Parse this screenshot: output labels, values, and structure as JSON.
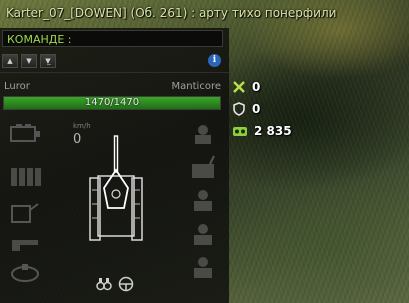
{
  "chat": {
    "message": "Karter_07_[DOWEN] (Об. 261) : арту тихо понерфили"
  },
  "team_chat": {
    "label": "КОМАНДЕ :"
  },
  "controls": {
    "icons": [
      "arrow-up-icon",
      "arrow-down-icon",
      "arrow-down-bar-icon"
    ],
    "info_icon": "i"
  },
  "vehicle": {
    "player_name": "Luror",
    "tank_name": "Manticore",
    "hp_current": 1470,
    "hp_max": 1470,
    "hp_text": "1470/1470",
    "speed_unit": "km/h",
    "speed_value": "0"
  },
  "stats": {
    "damage_assisted": "0",
    "damage_blocked": "0",
    "spotting_damage": "2 835"
  },
  "colors": {
    "accent_green": "#9bd84a",
    "hp_green": "#3aa52a",
    "info_blue": "#2c66b8"
  }
}
